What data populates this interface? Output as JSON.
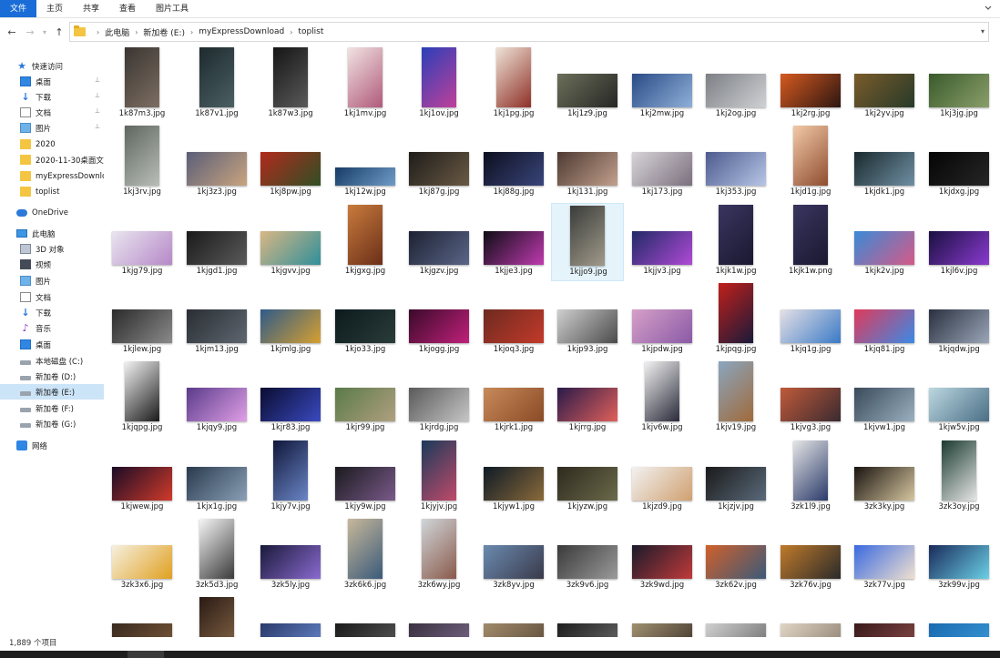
{
  "ribbon": {
    "tabs": [
      "文件",
      "主页",
      "共享",
      "查看",
      "图片工具"
    ],
    "collapse_icon": "chevron-down-icon"
  },
  "address": {
    "back_icon": "arrow-left-icon",
    "forward_icon": "arrow-right-icon",
    "history_icon": "chevron-down-icon",
    "up_icon": "arrow-up-icon",
    "crumbs": [
      "此电脑",
      "新加卷 (E:)",
      "myExpressDownload",
      "toplist"
    ]
  },
  "sidebar": {
    "items": [
      {
        "label": "快速访问",
        "icon": "star-icon",
        "pinned": false
      },
      {
        "label": "桌面",
        "icon": "desktop-icon",
        "pinned": true
      },
      {
        "label": "下载",
        "icon": "download-icon",
        "pinned": true
      },
      {
        "label": "文档",
        "icon": "document-icon",
        "pinned": true
      },
      {
        "label": "图片",
        "icon": "pictures-icon",
        "pinned": true
      },
      {
        "label": "2020",
        "icon": "folder-icon",
        "pinned": false
      },
      {
        "label": "2020-11-30桌面文",
        "icon": "folder-icon",
        "pinned": false
      },
      {
        "label": "myExpressDownlc",
        "icon": "folder-icon",
        "pinned": false
      },
      {
        "label": "toplist",
        "icon": "folder-icon",
        "pinned": false
      },
      {
        "label": "OneDrive",
        "icon": "cloud-icon",
        "pinned": false
      },
      {
        "label": "此电脑",
        "icon": "computer-icon",
        "pinned": false
      },
      {
        "label": "3D 对象",
        "icon": "cube-icon",
        "pinned": false
      },
      {
        "label": "视频",
        "icon": "video-icon",
        "pinned": false
      },
      {
        "label": "图片",
        "icon": "pictures-icon",
        "pinned": false
      },
      {
        "label": "文档",
        "icon": "document-icon",
        "pinned": false
      },
      {
        "label": "下载",
        "icon": "download-icon",
        "pinned": false
      },
      {
        "label": "音乐",
        "icon": "music-icon",
        "pinned": false
      },
      {
        "label": "桌面",
        "icon": "desktop-icon",
        "pinned": false
      },
      {
        "label": "本地磁盘 (C:)",
        "icon": "drive-icon",
        "pinned": false
      },
      {
        "label": "新加卷 (D:)",
        "icon": "drive-icon",
        "pinned": false
      },
      {
        "label": "新加卷 (E:)",
        "icon": "drive-icon",
        "pinned": false
      },
      {
        "label": "新加卷 (F:)",
        "icon": "drive-icon",
        "pinned": false
      },
      {
        "label": "新加卷 (G:)",
        "icon": "drive-icon",
        "pinned": false
      },
      {
        "label": "网络",
        "icon": "network-icon",
        "pinned": false
      }
    ]
  },
  "files": [
    {
      "name": "1k87m3.jpg",
      "orient": "portrait",
      "colors": [
        "#3a3532",
        "#7d6e62"
      ]
    },
    {
      "name": "1k87v1.jpg",
      "orient": "portrait",
      "colors": [
        "#1d2a2e",
        "#4b5f63"
      ]
    },
    {
      "name": "1k87w3.jpg",
      "orient": "portrait",
      "colors": [
        "#151515",
        "#5a5a5a"
      ]
    },
    {
      "name": "1kj1mv.jpg",
      "orient": "portrait",
      "colors": [
        "#f1e3e3",
        "#b05a7a"
      ]
    },
    {
      "name": "1kj1ov.jpg",
      "orient": "portrait",
      "colors": [
        "#2a3fb8",
        "#c0409a"
      ]
    },
    {
      "name": "1kj1pg.jpg",
      "orient": "portrait",
      "colors": [
        "#efe3d7",
        "#8e3027"
      ]
    },
    {
      "name": "1kj1z9.jpg",
      "orient": "landscape",
      "colors": [
        "#6c6f5a",
        "#262624"
      ]
    },
    {
      "name": "1kj2mw.jpg",
      "orient": "landscape",
      "colors": [
        "#2a4a86",
        "#8fb0d8"
      ]
    },
    {
      "name": "1kj2og.jpg",
      "orient": "landscape",
      "colors": [
        "#7c7f84",
        "#cfd1d4"
      ]
    },
    {
      "name": "1kj2rg.jpg",
      "orient": "landscape",
      "colors": [
        "#d65a1f",
        "#2c1612"
      ]
    },
    {
      "name": "1kj2yv.jpg",
      "orient": "landscape",
      "colors": [
        "#7a5b2a",
        "#263a29"
      ]
    },
    {
      "name": "1kj3jg.jpg",
      "orient": "landscape",
      "colors": [
        "#3a5a2c",
        "#8a9f6a"
      ]
    },
    {
      "name": "1kj3rv.jpg",
      "orient": "portrait",
      "colors": [
        "#5f6660",
        "#b9beb8"
      ]
    },
    {
      "name": "1kj3z3.jpg",
      "orient": "landscape",
      "colors": [
        "#5a5e79",
        "#c9a47e"
      ]
    },
    {
      "name": "1kj8pw.jpg",
      "orient": "landscape",
      "colors": [
        "#b12a1c",
        "#2f4f25"
      ]
    },
    {
      "name": "1kj12w.jpg",
      "orient": "wide",
      "colors": [
        "#173c66",
        "#6e9cc7"
      ]
    },
    {
      "name": "1kj87g.jpg",
      "orient": "landscape",
      "colors": [
        "#1e1c1a",
        "#6a5a44"
      ]
    },
    {
      "name": "1kj88g.jpg",
      "orient": "landscape",
      "colors": [
        "#0d0f1f",
        "#39457a"
      ]
    },
    {
      "name": "1kj131.jpg",
      "orient": "landscape",
      "colors": [
        "#4e3a33",
        "#c2a08c"
      ]
    },
    {
      "name": "1kj173.jpg",
      "orient": "landscape",
      "colors": [
        "#d8d4d8",
        "#7a6f7e"
      ]
    },
    {
      "name": "1kj353.jpg",
      "orient": "landscape",
      "colors": [
        "#4d5a8e",
        "#b6c6e6"
      ]
    },
    {
      "name": "1kjd1g.jpg",
      "orient": "portrait",
      "colors": [
        "#f2c9a8",
        "#8e4d2f"
      ]
    },
    {
      "name": "1kjdk1.jpg",
      "orient": "landscape",
      "colors": [
        "#1a2a2e",
        "#6f8fa3"
      ]
    },
    {
      "name": "1kjdxg.jpg",
      "orient": "landscape",
      "colors": [
        "#050505",
        "#262626"
      ]
    },
    {
      "name": "1kjg79.jpg",
      "orient": "landscape",
      "colors": [
        "#e9e5ef",
        "#b688c8"
      ]
    },
    {
      "name": "1kjgd1.jpg",
      "orient": "landscape",
      "colors": [
        "#1a1a1a",
        "#5a5a5a"
      ]
    },
    {
      "name": "1kjgvv.jpg",
      "orient": "landscape",
      "colors": [
        "#d9b784",
        "#2f8f9a"
      ]
    },
    {
      "name": "1kjgxg.jpg",
      "orient": "portrait",
      "colors": [
        "#c97b3c",
        "#6b2f19"
      ]
    },
    {
      "name": "1kjgzv.jpg",
      "orient": "landscape",
      "colors": [
        "#1d2132",
        "#5a6688"
      ]
    },
    {
      "name": "1kjje3.jpg",
      "orient": "landscape",
      "colors": [
        "#0d0d14",
        "#c03ab0"
      ]
    },
    {
      "name": "1kjjo9.jpg",
      "orient": "portrait",
      "colors": [
        "#3a3c3a",
        "#a09a8a"
      ]
    },
    {
      "name": "1kjjv3.jpg",
      "orient": "landscape",
      "colors": [
        "#202a66",
        "#b04ad6"
      ]
    },
    {
      "name": "1kjk1w.jpg",
      "orient": "portrait",
      "colors": [
        "#3a3560",
        "#1a1830"
      ]
    },
    {
      "name": "1kjk1w.png",
      "orient": "portrait",
      "colors": [
        "#3a3560",
        "#1a1830"
      ]
    },
    {
      "name": "1kjk2v.jpg",
      "orient": "landscape",
      "colors": [
        "#3a8ad6",
        "#d65a88"
      ]
    },
    {
      "name": "1kjl6v.jpg",
      "orient": "landscape",
      "colors": [
        "#1a1040",
        "#8a3ad0"
      ]
    },
    {
      "name": "1kjlew.jpg",
      "orient": "landscape",
      "colors": [
        "#2a2a2a",
        "#8a8a8a"
      ]
    },
    {
      "name": "1kjm13.jpg",
      "orient": "landscape",
      "colors": [
        "#2a2e33",
        "#5e6670"
      ]
    },
    {
      "name": "1kjmlg.jpg",
      "orient": "landscape",
      "colors": [
        "#2f5a88",
        "#d6a030"
      ]
    },
    {
      "name": "1kjo33.jpg",
      "orient": "landscape",
      "colors": [
        "#0c1a1c",
        "#2a3c3a"
      ]
    },
    {
      "name": "1kjogg.jpg",
      "orient": "landscape",
      "colors": [
        "#3a0a2a",
        "#c0207a"
      ]
    },
    {
      "name": "1kjoq3.jpg",
      "orient": "landscape",
      "colors": [
        "#6e2a20",
        "#c23a2a"
      ]
    },
    {
      "name": "1kjp93.jpg",
      "orient": "landscape",
      "colors": [
        "#cfcfcf",
        "#4a4a4a"
      ]
    },
    {
      "name": "1kjpdw.jpg",
      "orient": "landscape",
      "colors": [
        "#d6a0c8",
        "#8a5aa6"
      ]
    },
    {
      "name": "1kjpqg.jpg",
      "orient": "portrait",
      "colors": [
        "#c0201a",
        "#1a1a3a"
      ]
    },
    {
      "name": "1kjq1g.jpg",
      "orient": "landscape",
      "colors": [
        "#e6e0e6",
        "#3a7ac6"
      ]
    },
    {
      "name": "1kjq81.jpg",
      "orient": "landscape",
      "colors": [
        "#e03a5a",
        "#3a8ae6"
      ]
    },
    {
      "name": "1kjqdw.jpg",
      "orient": "landscape",
      "colors": [
        "#2a3040",
        "#9aa6b8"
      ]
    },
    {
      "name": "1kjqpg.jpg",
      "orient": "portrait",
      "colors": [
        "#f2f2f2",
        "#1a1a1a"
      ]
    },
    {
      "name": "1kjqy9.jpg",
      "orient": "landscape",
      "colors": [
        "#5a3a8a",
        "#e0a0e6"
      ]
    },
    {
      "name": "1kjr83.jpg",
      "orient": "landscape",
      "colors": [
        "#0a0c30",
        "#3a4ac0"
      ]
    },
    {
      "name": "1kjr99.jpg",
      "orient": "landscape",
      "colors": [
        "#5a7a4a",
        "#b0a080"
      ]
    },
    {
      "name": "1kjrdg.jpg",
      "orient": "landscape",
      "colors": [
        "#5a5a5a",
        "#c6c6c6"
      ]
    },
    {
      "name": "1kjrk1.jpg",
      "orient": "landscape",
      "colors": [
        "#c88a5a",
        "#8a4a26"
      ]
    },
    {
      "name": "1kjrrg.jpg",
      "orient": "landscape",
      "colors": [
        "#2a1a4a",
        "#e0605a"
      ]
    },
    {
      "name": "1kjv6w.jpg",
      "orient": "portrait",
      "colors": [
        "#f2f2f2",
        "#2a2a3a"
      ]
    },
    {
      "name": "1kjv19.jpg",
      "orient": "portrait",
      "colors": [
        "#8aa6c0",
        "#a06a3a"
      ]
    },
    {
      "name": "1kjvg3.jpg",
      "orient": "landscape",
      "colors": [
        "#c05a3a",
        "#3a2a30"
      ]
    },
    {
      "name": "1kjvw1.jpg",
      "orient": "landscape",
      "colors": [
        "#3a4a5a",
        "#9ab0c0"
      ]
    },
    {
      "name": "1kjw5v.jpg",
      "orient": "landscape",
      "colors": [
        "#bcd8e0",
        "#4a6e86"
      ]
    },
    {
      "name": "1kjwew.jpg",
      "orient": "landscape",
      "colors": [
        "#1a0c26",
        "#d03a2a"
      ]
    },
    {
      "name": "1kjx1g.jpg",
      "orient": "landscape",
      "colors": [
        "#2a3a4e",
        "#8aa0b6"
      ]
    },
    {
      "name": "1kjy7v.jpg",
      "orient": "portrait",
      "colors": [
        "#10163a",
        "#6a86c6"
      ]
    },
    {
      "name": "1kjy9w.jpg",
      "orient": "landscape",
      "colors": [
        "#1a1a1e",
        "#7a5a8a"
      ]
    },
    {
      "name": "1kjyjv.jpg",
      "orient": "portrait",
      "colors": [
        "#1a3a5a",
        "#c04a6a"
      ]
    },
    {
      "name": "1kjyw1.jpg",
      "orient": "landscape",
      "colors": [
        "#0e1a26",
        "#8a6a3a"
      ]
    },
    {
      "name": "1kjyzw.jpg",
      "orient": "landscape",
      "colors": [
        "#2e2a1e",
        "#6a6a4a"
      ]
    },
    {
      "name": "1kjzd9.jpg",
      "orient": "landscape",
      "colors": [
        "#f2f2f2",
        "#d0a070"
      ]
    },
    {
      "name": "1kjzjv.jpg",
      "orient": "landscape",
      "colors": [
        "#1a1a1a",
        "#5a6a7a"
      ]
    },
    {
      "name": "3zk1l9.jpg",
      "orient": "portrait",
      "colors": [
        "#e6e6e6",
        "#2a3a6a"
      ]
    },
    {
      "name": "3zk3ky.jpg",
      "orient": "landscape",
      "colors": [
        "#1a1410",
        "#d6c6a0"
      ]
    },
    {
      "name": "3zk3oy.jpg",
      "orient": "portrait",
      "colors": [
        "#1a3a30",
        "#e6e6e6"
      ]
    },
    {
      "name": "3zk3x6.jpg",
      "orient": "landscape",
      "colors": [
        "#f6f0e0",
        "#e0a020"
      ]
    },
    {
      "name": "3zk5d3.jpg",
      "orient": "portrait",
      "colors": [
        "#f6f6f6",
        "#3a3a3a"
      ]
    },
    {
      "name": "3zk5ly.jpg",
      "orient": "landscape",
      "colors": [
        "#1a1a3a",
        "#8a6ad0"
      ]
    },
    {
      "name": "3zk6k6.jpg",
      "orient": "portrait",
      "colors": [
        "#c8b89a",
        "#3a5a7a"
      ]
    },
    {
      "name": "3zk6wy.jpg",
      "orient": "portrait",
      "colors": [
        "#d0d6da",
        "#8a5a4a"
      ]
    },
    {
      "name": "3zk8yv.jpg",
      "orient": "landscape",
      "colors": [
        "#6a8ab0",
        "#3a3a4a"
      ]
    },
    {
      "name": "3zk9v6.jpg",
      "orient": "landscape",
      "colors": [
        "#3a3a3a",
        "#9a9a9a"
      ]
    },
    {
      "name": "3zk9wd.jpg",
      "orient": "landscape",
      "colors": [
        "#1a1a2a",
        "#c03a3a"
      ]
    },
    {
      "name": "3zk62v.jpg",
      "orient": "landscape",
      "colors": [
        "#d0602a",
        "#3a5a7a"
      ]
    },
    {
      "name": "3zk76v.jpg",
      "orient": "landscape",
      "colors": [
        "#c07a2a",
        "#2a2a2a"
      ]
    },
    {
      "name": "3zk77v.jpg",
      "orient": "landscape",
      "colors": [
        "#3a6ae0",
        "#f0e0d0"
      ]
    },
    {
      "name": "3zk99v.jpg",
      "orient": "landscape",
      "colors": [
        "#1a2a5a",
        "#6ad0e6"
      ]
    },
    {
      "name": "",
      "orient": "landscape",
      "colors": [
        "#3a2a20",
        "#7a5a3a"
      ]
    },
    {
      "name": "",
      "orient": "portrait",
      "colors": [
        "#2a1a14",
        "#8a6a4a"
      ]
    },
    {
      "name": "",
      "orient": "landscape",
      "colors": [
        "#2a3a6a",
        "#6a8ad0"
      ]
    },
    {
      "name": "",
      "orient": "landscape",
      "colors": [
        "#1a1a1a",
        "#5a5a5a"
      ]
    },
    {
      "name": "",
      "orient": "landscape",
      "colors": [
        "#3a3040",
        "#7a6a8a"
      ]
    },
    {
      "name": "",
      "orient": "landscape",
      "colors": [
        "#a08a6a",
        "#5a4a3a"
      ]
    },
    {
      "name": "",
      "orient": "landscape",
      "colors": [
        "#1e1e1e",
        "#6a6a6a"
      ]
    },
    {
      "name": "",
      "orient": "landscape",
      "colors": [
        "#a09070",
        "#3a3028"
      ]
    },
    {
      "name": "",
      "orient": "landscape",
      "colors": [
        "#d0d0d0",
        "#6a6a6a"
      ]
    },
    {
      "name": "",
      "orient": "landscape",
      "colors": [
        "#e0d6c6",
        "#8a7a6a"
      ]
    },
    {
      "name": "",
      "orient": "landscape",
      "colors": [
        "#3a1a1a",
        "#8a4a4a"
      ]
    },
    {
      "name": "",
      "orient": "landscape",
      "colors": [
        "#1a6ab0",
        "#3a9ad6"
      ]
    }
  ],
  "status": {
    "item_count": "1,889 个项目"
  },
  "theme": {
    "accent": "#1a6dd6",
    "selection": "#cce4f7"
  }
}
